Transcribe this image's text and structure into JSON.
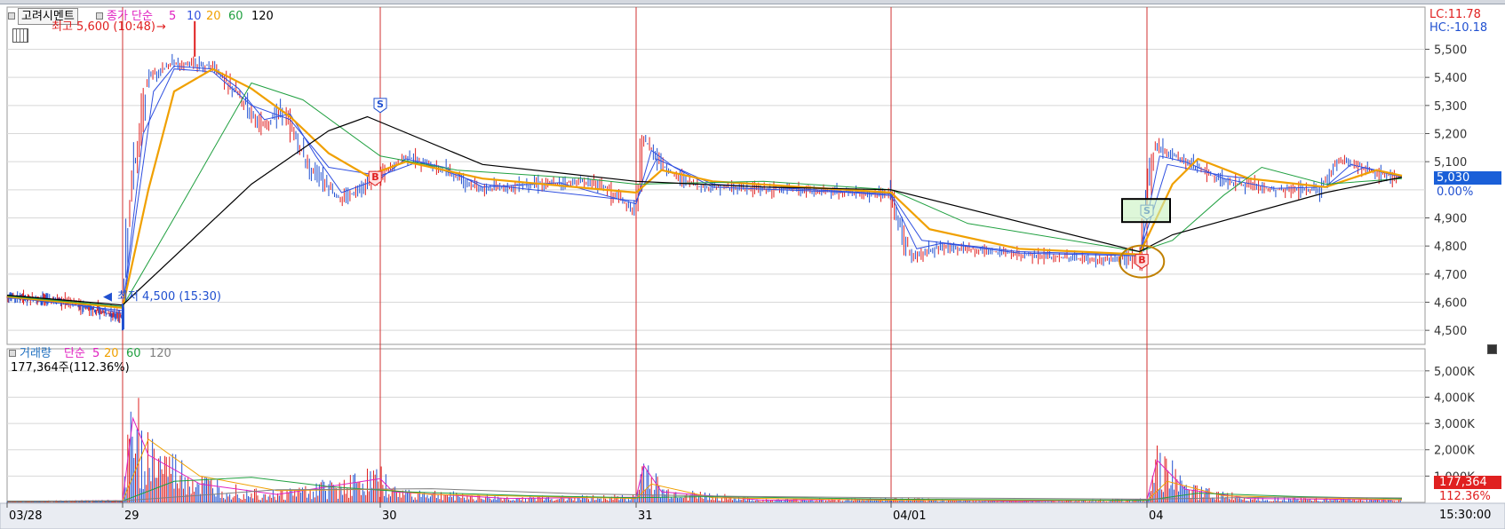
{
  "title": "고려시멘트",
  "colors": {
    "grid": "#d8d8d8",
    "session_line": "#d23232",
    "price_up": "#e02020",
    "price_down": "#2050d0",
    "ma5": "#3050e0",
    "ma10": "#3050e0",
    "ma20": "#f0a000",
    "ma60": "#20a040",
    "ma120": "#000000",
    "vol_ma5": "#e020c0",
    "vol_ma20": "#f0a000",
    "vol_ma60": "#20a040",
    "vol_ma120": "#808080",
    "current_price_bg": "#1a5fd8",
    "current_volume_bg": "#e02020"
  },
  "price_panel": {
    "legend": {
      "label": "종가 단순",
      "p5": "5",
      "p10": "10",
      "p20": "20",
      "p60": "60",
      "p120": "120"
    },
    "high_label": "최고 5,600 (10:48)",
    "low_label": "최저 4,500 (15:30)",
    "lc": "LC:11.78",
    "hc": "HC:-10.18",
    "current_price": "5,030",
    "current_change": "0.00%",
    "axis_ticks": [
      "5,500",
      "5,400",
      "5,300",
      "5,200",
      "5,100",
      "4,900",
      "4,800",
      "4,700",
      "4,600",
      "4,500"
    ]
  },
  "volume_panel": {
    "legend": {
      "label": "거래량",
      "sub": "단순",
      "p5": "5",
      "p20": "20",
      "p60": "60",
      "p120": "120"
    },
    "info": "177,364주(112.36%)",
    "axis_ticks": [
      "5,000K",
      "4,000K",
      "3,000K",
      "2,000K",
      "1,000K"
    ],
    "current_volume": "177,364",
    "current_ratio": "112.36%"
  },
  "x_axis": {
    "labels": [
      "03/28",
      "29",
      "30",
      "31",
      "04/01",
      "04"
    ],
    "end_time": "15:30:00"
  },
  "chart_data": {
    "type": "line",
    "title": "고려시멘트",
    "xlabel": "",
    "ylabel": "",
    "x": [
      "03/28",
      "29",
      "30",
      "31",
      "04/01",
      "04"
    ],
    "ylim": [
      4450,
      5650
    ],
    "grid": true,
    "legend": "top-left",
    "price_series": [
      {
        "name": "종가",
        "points": [
          [
            0.0,
            4620
          ],
          [
            0.5,
            4605
          ],
          [
            1.0,
            4545
          ],
          [
            1.03,
            4990
          ],
          [
            1.1,
            5400
          ],
          [
            1.2,
            5450
          ],
          [
            1.35,
            5440
          ],
          [
            1.45,
            5340
          ],
          [
            1.55,
            5220
          ],
          [
            1.62,
            5290
          ],
          [
            1.72,
            5090
          ],
          [
            1.85,
            4960
          ],
          [
            2.0,
            5050
          ],
          [
            2.1,
            5120
          ],
          [
            2.25,
            5070
          ],
          [
            2.4,
            5000
          ],
          [
            2.6,
            5020
          ],
          [
            2.85,
            5030
          ],
          [
            3.0,
            4920
          ],
          [
            3.03,
            5180
          ],
          [
            3.12,
            5070
          ],
          [
            3.25,
            5010
          ],
          [
            3.6,
            5000
          ],
          [
            3.85,
            4990
          ],
          [
            4.0,
            4980
          ],
          [
            4.08,
            4760
          ],
          [
            4.2,
            4800
          ],
          [
            4.5,
            4770
          ],
          [
            4.8,
            4750
          ],
          [
            4.97,
            4760
          ],
          [
            5.03,
            5160
          ],
          [
            5.12,
            5120
          ],
          [
            5.3,
            5030
          ],
          [
            5.5,
            5000
          ],
          [
            5.68,
            5000
          ],
          [
            5.75,
            5110
          ],
          [
            5.9,
            5060
          ],
          [
            6.0,
            5040
          ]
        ]
      },
      {
        "name": "5",
        "points": [
          [
            0.0,
            4615
          ],
          [
            0.5,
            4605
          ],
          [
            1.0,
            4560
          ],
          [
            1.05,
            4900
          ],
          [
            1.12,
            5350
          ],
          [
            1.2,
            5440
          ],
          [
            1.35,
            5430
          ],
          [
            1.45,
            5360
          ],
          [
            1.55,
            5250
          ],
          [
            1.65,
            5270
          ],
          [
            1.75,
            5120
          ],
          [
            1.85,
            4990
          ],
          [
            2.0,
            5040
          ],
          [
            2.1,
            5110
          ],
          [
            2.25,
            5080
          ],
          [
            2.4,
            5010
          ],
          [
            2.7,
            5025
          ],
          [
            3.0,
            4950
          ],
          [
            3.06,
            5140
          ],
          [
            3.15,
            5080
          ],
          [
            3.3,
            5010
          ],
          [
            3.85,
            4990
          ],
          [
            4.0,
            4980
          ],
          [
            4.1,
            4790
          ],
          [
            4.2,
            4810
          ],
          [
            4.5,
            4775
          ],
          [
            4.97,
            4765
          ],
          [
            5.05,
            5120
          ],
          [
            5.15,
            5100
          ],
          [
            5.3,
            5040
          ],
          [
            5.5,
            5005
          ],
          [
            5.7,
            5010
          ],
          [
            5.8,
            5090
          ],
          [
            6.0,
            5045
          ]
        ]
      },
      {
        "name": "10",
        "points": [
          [
            0.0,
            4618
          ],
          [
            1.0,
            4570
          ],
          [
            1.08,
            5200
          ],
          [
            1.2,
            5430
          ],
          [
            1.35,
            5420
          ],
          [
            1.5,
            5300
          ],
          [
            1.65,
            5250
          ],
          [
            1.8,
            5080
          ],
          [
            2.0,
            5050
          ],
          [
            2.15,
            5100
          ],
          [
            2.4,
            5020
          ],
          [
            3.0,
            4960
          ],
          [
            3.08,
            5110
          ],
          [
            3.3,
            5020
          ],
          [
            4.0,
            4985
          ],
          [
            4.12,
            4820
          ],
          [
            4.5,
            4780
          ],
          [
            4.97,
            4768
          ],
          [
            5.08,
            5090
          ],
          [
            5.3,
            5050
          ],
          [
            5.7,
            5010
          ],
          [
            5.85,
            5080
          ],
          [
            6.0,
            5050
          ]
        ]
      },
      {
        "name": "20",
        "points": [
          [
            0.0,
            4620
          ],
          [
            1.0,
            4580
          ],
          [
            1.1,
            5000
          ],
          [
            1.2,
            5350
          ],
          [
            1.35,
            5430
          ],
          [
            1.5,
            5360
          ],
          [
            1.65,
            5260
          ],
          [
            1.8,
            5130
          ],
          [
            1.95,
            5050
          ],
          [
            2.1,
            5100
          ],
          [
            2.4,
            5040
          ],
          [
            3.0,
            4990
          ],
          [
            3.1,
            5070
          ],
          [
            3.3,
            5030
          ],
          [
            4.0,
            4990
          ],
          [
            4.15,
            4860
          ],
          [
            4.5,
            4790
          ],
          [
            4.97,
            4770
          ],
          [
            5.1,
            5020
          ],
          [
            5.2,
            5110
          ],
          [
            5.4,
            5040
          ],
          [
            5.7,
            5010
          ],
          [
            5.9,
            5070
          ],
          [
            6.0,
            5050
          ]
        ]
      },
      {
        "name": "60",
        "points": [
          [
            0.0,
            4622
          ],
          [
            1.0,
            4585
          ],
          [
            1.2,
            4900
          ],
          [
            1.5,
            5380
          ],
          [
            1.7,
            5320
          ],
          [
            2.0,
            5120
          ],
          [
            2.3,
            5070
          ],
          [
            2.8,
            5040
          ],
          [
            3.0,
            5020
          ],
          [
            3.5,
            5030
          ],
          [
            4.0,
            5000
          ],
          [
            4.3,
            4880
          ],
          [
            4.97,
            4780
          ],
          [
            5.1,
            4820
          ],
          [
            5.3,
            4980
          ],
          [
            5.45,
            5080
          ],
          [
            5.7,
            5020
          ],
          [
            6.0,
            5040
          ]
        ]
      },
      {
        "name": "120",
        "points": [
          [
            0.0,
            4625
          ],
          [
            1.0,
            4590
          ],
          [
            1.5,
            5020
          ],
          [
            1.8,
            5210
          ],
          [
            1.95,
            5260
          ],
          [
            2.4,
            5090
          ],
          [
            3.0,
            5030
          ],
          [
            3.5,
            5010
          ],
          [
            4.0,
            5000
          ],
          [
            4.97,
            4780
          ],
          [
            5.1,
            4840
          ],
          [
            5.7,
            4990
          ],
          [
            6.0,
            5045
          ]
        ]
      }
    ],
    "volume_series": [
      {
        "name": "5",
        "points": [
          [
            0.0,
            40
          ],
          [
            1.0,
            60
          ],
          [
            1.04,
            3200
          ],
          [
            1.1,
            1800
          ],
          [
            1.3,
            700
          ],
          [
            1.6,
            300
          ],
          [
            2.0,
            900
          ],
          [
            2.05,
            400
          ],
          [
            2.5,
            150
          ],
          [
            3.0,
            200
          ],
          [
            3.03,
            1400
          ],
          [
            3.1,
            400
          ],
          [
            3.5,
            80
          ],
          [
            4.0,
            120
          ],
          [
            4.5,
            40
          ],
          [
            5.0,
            100
          ],
          [
            5.04,
            1600
          ],
          [
            5.15,
            500
          ],
          [
            5.4,
            150
          ],
          [
            5.7,
            120
          ],
          [
            6.0,
            90
          ]
        ]
      },
      {
        "name": "20",
        "points": [
          [
            0.0,
            40
          ],
          [
            1.0,
            50
          ],
          [
            1.1,
            2400
          ],
          [
            1.3,
            1000
          ],
          [
            1.6,
            450
          ],
          [
            2.0,
            500
          ],
          [
            2.2,
            300
          ],
          [
            3.0,
            150
          ],
          [
            3.06,
            700
          ],
          [
            3.3,
            180
          ],
          [
            4.0,
            80
          ],
          [
            5.0,
            70
          ],
          [
            5.08,
            800
          ],
          [
            5.3,
            250
          ],
          [
            6.0,
            100
          ]
        ]
      },
      {
        "name": "60",
        "points": [
          [
            0.0,
            40
          ],
          [
            1.0,
            50
          ],
          [
            1.2,
            800
          ],
          [
            1.5,
            950
          ],
          [
            1.8,
            600
          ],
          [
            2.1,
            400
          ],
          [
            2.6,
            250
          ],
          [
            3.0,
            180
          ],
          [
            3.3,
            220
          ],
          [
            4.0,
            120
          ],
          [
            5.0,
            80
          ],
          [
            5.2,
            350
          ],
          [
            5.6,
            220
          ],
          [
            6.0,
            140
          ]
        ]
      },
      {
        "name": "120",
        "points": [
          [
            0.0,
            40
          ],
          [
            1.0,
            60
          ],
          [
            1.6,
            480
          ],
          [
            2.2,
            520
          ],
          [
            2.8,
            320
          ],
          [
            3.4,
            230
          ],
          [
            4.0,
            180
          ],
          [
            5.0,
            120
          ],
          [
            5.5,
            200
          ],
          [
            6.0,
            170
          ]
        ]
      }
    ],
    "volume_ylim": [
      0,
      5500
    ],
    "volume_unit": "K",
    "signals": [
      {
        "type": "S",
        "x": 2.0,
        "price": 5300
      },
      {
        "type": "B",
        "x": 1.98,
        "price": 5040
      },
      {
        "type": "S",
        "x": 5.0,
        "price": 4920
      },
      {
        "type": "B",
        "x": 4.98,
        "price": 4745
      }
    ],
    "extremes": {
      "high": 5600,
      "low": 4500
    }
  }
}
